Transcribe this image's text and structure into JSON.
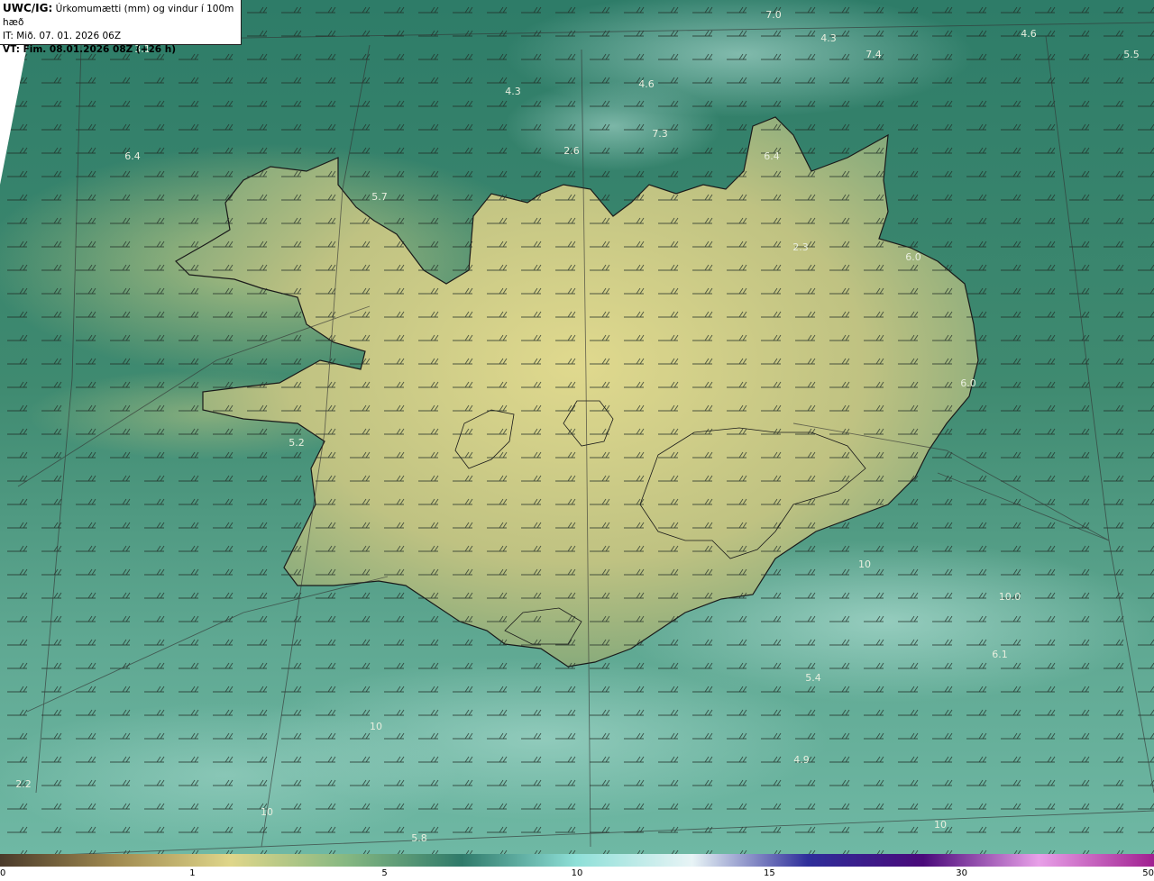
{
  "header": {
    "model": "UWC/IG:",
    "title": "Úrkomumætti (mm) og vindur í 100m hæð",
    "init_prefix": "IT:",
    "init_time": "Mið. 07. 01. 2026 06Z",
    "valid_prefix": "VT:",
    "valid_time": "Fim. 08.01.2026 08Z (+26 h)"
  },
  "colorbar": {
    "ticks": [
      {
        "label": "0",
        "frac": 0.0
      },
      {
        "label": "1",
        "frac": 0.1667
      },
      {
        "label": "5",
        "frac": 0.3333
      },
      {
        "label": "10",
        "frac": 0.5
      },
      {
        "label": "15",
        "frac": 0.6667
      },
      {
        "label": "30",
        "frac": 0.8333
      },
      {
        "label": "50",
        "frac": 1.0
      }
    ],
    "colors": [
      "#4a3a2a",
      "#a08a50",
      "#dfd68a",
      "#86b882",
      "#2f7a6a",
      "#8fe0d8",
      "#e8f4f6",
      "#2e2e9a",
      "#4a0a7a",
      "#e8a0e8",
      "#a02090"
    ]
  },
  "value_labels": [
    "7.0",
    "4.3",
    "7.4",
    "4.6",
    "5.5",
    "3.1",
    "4.3",
    "4.6",
    "7.3",
    "6.4",
    "2.6",
    "6.4",
    "5.7",
    "2.3",
    "6.0",
    "6.0",
    "5.2",
    "10",
    "10.0",
    "6.1",
    "5.4",
    "10",
    "4.9",
    "2.2",
    "5.8",
    "10",
    "10"
  ],
  "colors": {
    "sea_dark": "#2e7a66",
    "land_light": "#d8d48c",
    "coast": "#1a1a1a"
  }
}
